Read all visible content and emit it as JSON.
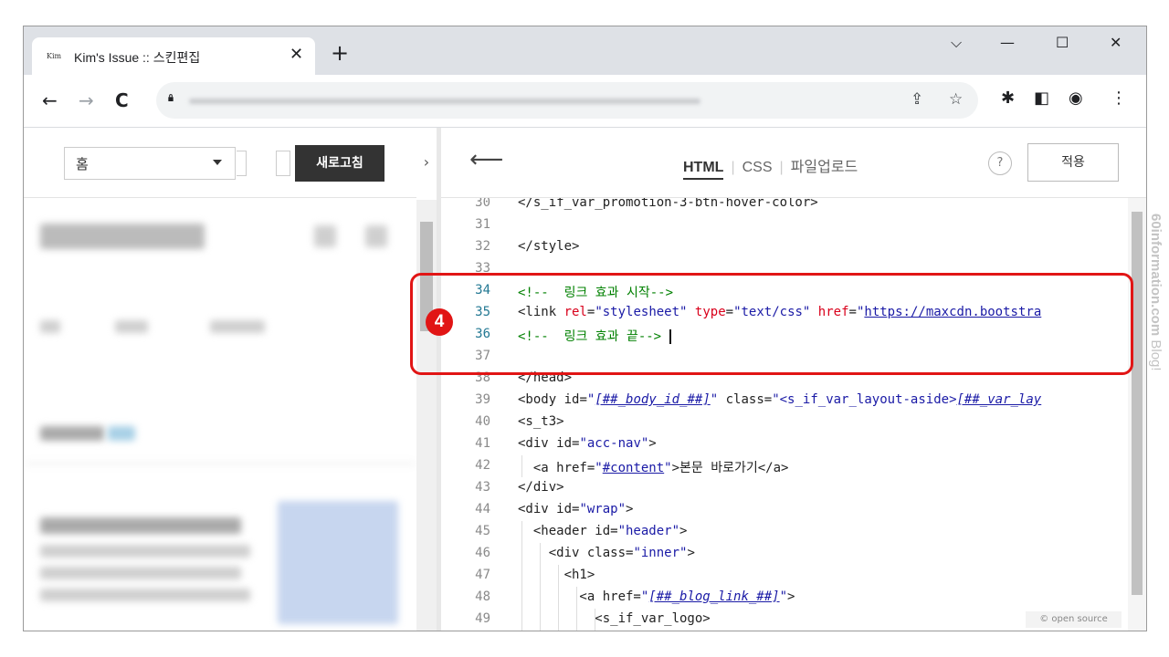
{
  "browser": {
    "tab_title": "Kim's Issue :: 스킨편집",
    "tab_favicon_text": "Kim",
    "close_glyph": "✕",
    "new_tab_glyph": "+",
    "window_controls": [
      "⌵",
      "—",
      "☐",
      "✕"
    ],
    "nav": {
      "back": "←",
      "forward": "→",
      "reload": "C"
    },
    "omnibox_icons": [
      "⇪",
      "☆"
    ],
    "toolbar_icons": [
      "✱",
      "◧",
      "◉",
      "⋮"
    ]
  },
  "left_panel": {
    "select_value": "홈",
    "refresh_label": "새로고침",
    "collapse_glyph": "›"
  },
  "editor": {
    "back_glyph": "⟵",
    "tabs": [
      {
        "label": "HTML",
        "active": true
      },
      {
        "label": "CSS",
        "active": false
      },
      {
        "label": "파일업로드",
        "active": false
      }
    ],
    "help_label": "?",
    "apply_label": "적용",
    "open_source_label": "© open source",
    "lines": [
      {
        "n": "30",
        "html": "&lt;/s_if_var_promotion-3-btn-hover-color&gt;"
      },
      {
        "n": "31",
        "html": ""
      },
      {
        "n": "32",
        "html": "&lt;/style&gt;"
      },
      {
        "n": "33",
        "html": ""
      },
      {
        "n": "34",
        "html": "<span class='cmt'>&lt;!--  링크 효과 시작--&gt;</span>"
      },
      {
        "n": "35",
        "html": "&lt;link <span class='attr'>rel</span>=<span class='str'>\"stylesheet\"</span> <span class='attr'>type</span>=<span class='str'>\"text/css\"</span> <span class='attr'>href</span>=<span class='str'>\"</span><span class='url'>https://maxcdn.bootstra</span>"
      },
      {
        "n": "36",
        "html": "<span class='cmt'>&lt;!--  링크 효과 끝--&gt;</span> <span style='border-left:2px solid #111'></span>"
      },
      {
        "n": "37",
        "html": ""
      },
      {
        "n": "38",
        "html": "&lt;/head&gt;"
      },
      {
        "n": "39",
        "html": "&lt;body <span class='tag'>id</span>=<span class='str'>\"</span><span class='tpl'>[##_body_id_##]</span><span class='str'>\"</span> class=<span class='str'>\"&lt;s_if_var_layout-aside&gt;</span><span class='tpl'>[##_var_lay</span>"
      },
      {
        "n": "40",
        "html": "&lt;s_t3&gt;"
      },
      {
        "n": "41",
        "html": "&lt;div id=<span class='str'>\"acc-nav\"</span>&gt;"
      },
      {
        "n": "42",
        "html": "  &lt;a href=<span class='str'>\"</span><span class='url'>#content</span><span class='str'>\"</span>&gt;본문 바로가기&lt;/a&gt;"
      },
      {
        "n": "43",
        "html": "&lt;/div&gt;"
      },
      {
        "n": "44",
        "html": "&lt;div id=<span class='str'>\"wrap\"</span>&gt;"
      },
      {
        "n": "45",
        "html": "  &lt;header id=<span class='str'>\"header\"</span>&gt;"
      },
      {
        "n": "46",
        "html": "    &lt;div class=<span class='str'>\"inner\"</span>&gt;"
      },
      {
        "n": "47",
        "html": "      &lt;h1&gt;"
      },
      {
        "n": "48",
        "html": "        &lt;a href=<span class='str'>\"</span><span class='tpl'>[##_blog_link_##]</span><span class='str'>\"</span>&gt;"
      },
      {
        "n": "49",
        "html": "          &lt;s_if_var_logo&gt;"
      }
    ]
  },
  "annotation": {
    "step_number": "4"
  },
  "watermark": {
    "bold": "60information.com",
    "normal": " Blog!"
  }
}
